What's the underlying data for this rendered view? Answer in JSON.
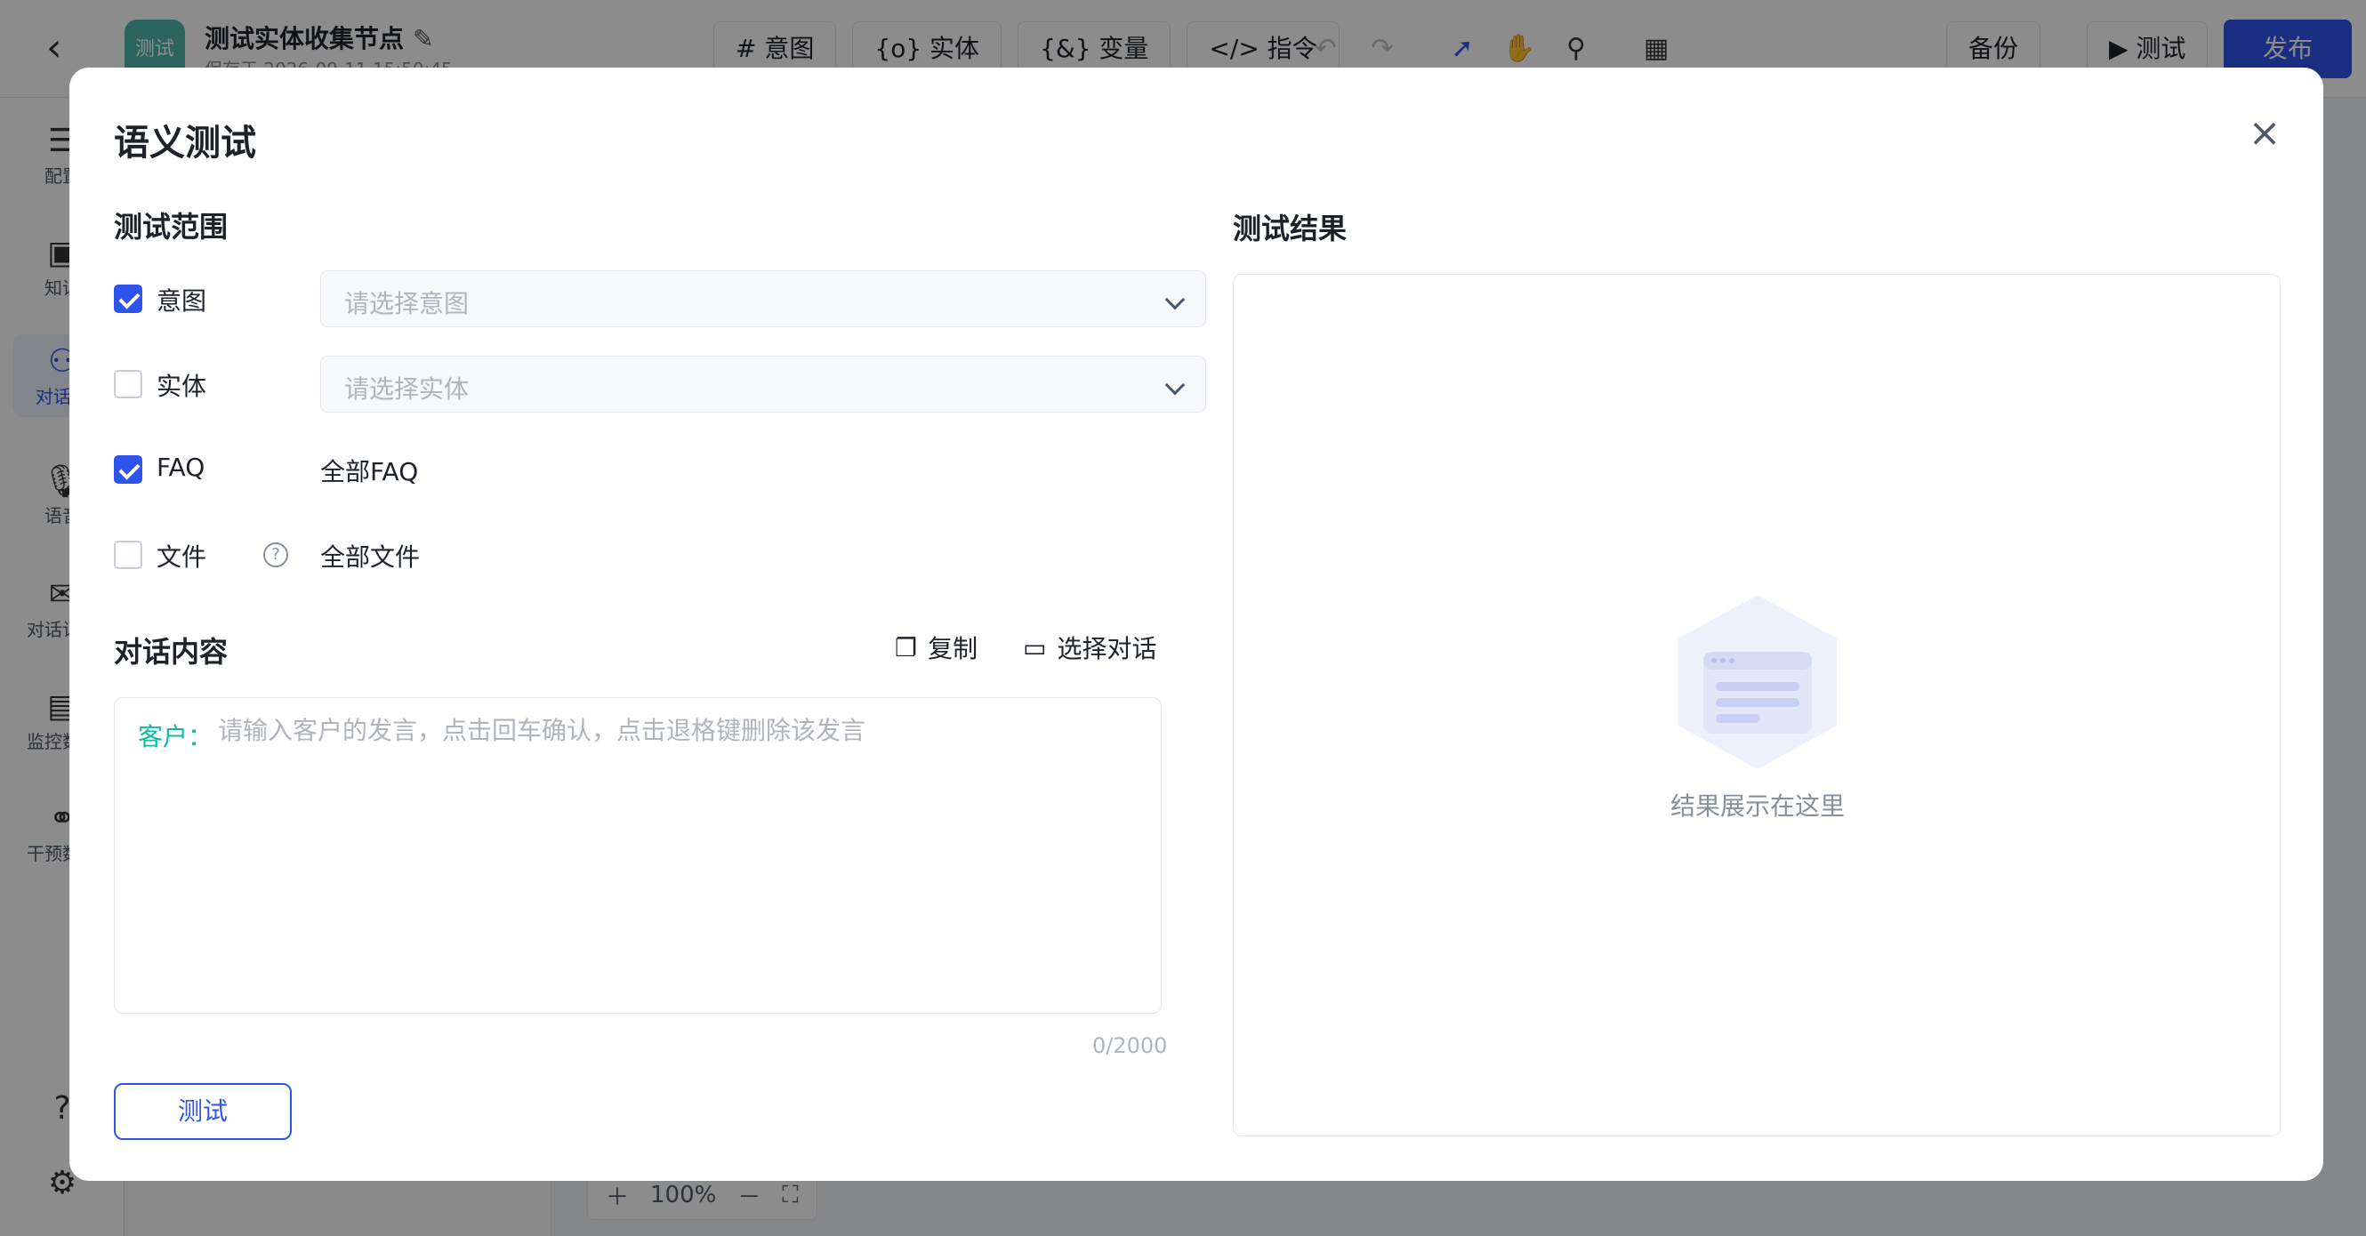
{
  "app": {
    "back_icon": "chevron-left-icon",
    "badge": "测试",
    "flow_title": "测试实体收集节点",
    "saved_at": "保存于 2026-09-11 15:50:45"
  },
  "toolbar": {
    "intent": "# 意图",
    "entity": "{o} 实体",
    "variable": "{&} 变量",
    "command": "</> 指令",
    "backup": "备份",
    "test": "▶ 测试",
    "publish": "发布"
  },
  "sidebar": {
    "items": [
      {
        "label": "配置",
        "icon": "settings-icon"
      },
      {
        "label": "知识",
        "icon": "book-icon"
      },
      {
        "label": "对话流",
        "icon": "flow-icon"
      },
      {
        "label": "语音",
        "icon": "mic-icon"
      },
      {
        "label": "对话记录",
        "icon": "chat-icon"
      },
      {
        "label": "监控数据",
        "icon": "chart-icon"
      },
      {
        "label": "干预数据",
        "icon": "intervene-icon"
      }
    ]
  },
  "canvas": {
    "zoom": "100%"
  },
  "modal": {
    "title": "语义测试",
    "scope": {
      "title": "测试范围",
      "intent": {
        "label": "意图",
        "checked": true,
        "placeholder": "请选择意图"
      },
      "entity": {
        "label": "实体",
        "checked": false,
        "placeholder": "请选择实体"
      },
      "faq": {
        "label": "FAQ",
        "checked": true,
        "value": "全部FAQ"
      },
      "file": {
        "label": "文件",
        "checked": false,
        "value": "全部文件"
      }
    },
    "dialog": {
      "title": "对话内容",
      "copy": "复制",
      "select": "选择对话",
      "role": "客户：",
      "placeholder": "请输入客户的发言，点击回车确认，点击退格键删除该发言",
      "counter": "0/2000"
    },
    "test_button": "测试",
    "result": {
      "title": "测试结果",
      "empty": "结果展示在这里"
    }
  }
}
